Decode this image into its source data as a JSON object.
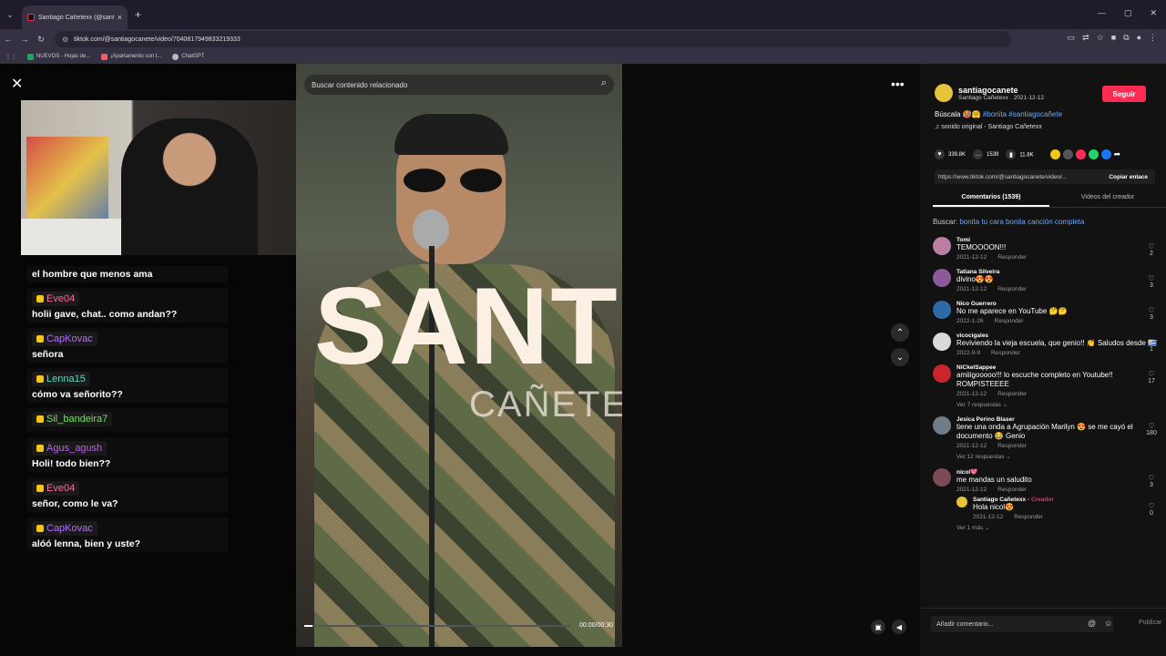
{
  "browser": {
    "tab_title": "Santiago Cañetexx (@santi...",
    "url": "tiktok.com/@santiagocanete/video/7040817949833219333",
    "bookmarks": [
      "NUEVOS - Hojas de...",
      "¡Apartamento con t...",
      "ChatGPT"
    ]
  },
  "chat": [
    {
      "user": "",
      "text": "el hombre que menos ama",
      "color": "#ffffff"
    },
    {
      "user": "Eve04",
      "text": "holii gave, chat.. como andan??",
      "color": "#ff6b9d"
    },
    {
      "user": "CapKovac",
      "text": "señora",
      "color": "#b46bff"
    },
    {
      "user": "Lenna15",
      "text": "cómo va señorito??",
      "color": "#5fd7c0"
    },
    {
      "user": "Sil_bandeira7",
      "text": "",
      "color": "#77dd66"
    },
    {
      "user": "Agus_agush",
      "text": "Holi! todo bien??",
      "color": "#c25bff"
    },
    {
      "user": "Eve04",
      "text": "señor, como le va?",
      "color": "#ff6b9d"
    },
    {
      "user": "CapKovac",
      "text": "alóó lenna, bien y uste?",
      "color": "#b46bff"
    }
  ],
  "video": {
    "search_placeholder": "Buscar contenido relacionado",
    "overlay_title": "SANTIA",
    "overlay_sub": "CAÑETE",
    "time": "00:00/00:30",
    "progress": 0.03
  },
  "author": {
    "username": "santiagocanete",
    "display": "Santiago Cañetexx · 2021-12-12",
    "follow": "Seguir",
    "desc_text": "Búscala 🥵🤗 ",
    "desc_tags": "#bonita #santiagocañete",
    "music": "♫  sonido original - Santiago Cañetexx"
  },
  "stats": {
    "likes": "339.8K",
    "comments": "1539",
    "saves": "11.8K"
  },
  "link": {
    "url": "https://www.tiktok.com/@santiagocanete/video/...",
    "copy": "Copiar enlace"
  },
  "tabs": [
    "Comentarios (1539)",
    "Videos del creador"
  ],
  "buscar": {
    "label": "Buscar:",
    "query": "bonita tu cara bonita canción completa"
  },
  "reply_label": "Responder",
  "comments": [
    {
      "name": "Tomi",
      "text": "TEMOOOON!!!",
      "date": "2021-12-12",
      "likes": "2",
      "color": "#b97fa2"
    },
    {
      "name": "Tatiana Silveira",
      "text": "divino😍😍",
      "date": "2021-12-12",
      "likes": "3",
      "color": "#8c5a9c"
    },
    {
      "name": "Nico Guerrero",
      "text": "No me aparece en YouTube 🤔🤔",
      "date": "2022-1-26",
      "likes": "3",
      "color": "#2e6aa6"
    },
    {
      "name": "vicocigales",
      "text": "Reviviendo la vieja escuela, que genio!! 👏 Saludos desde 🇺🇾",
      "date": "2022-9-9",
      "likes": "1",
      "color": "#d9d9d9"
    },
    {
      "name": "NiCkelSappee",
      "text": "amiiigooooo!!! lo escuche completo en Youtube!! ROMPISTEEEE",
      "date": "2021-12-12",
      "likes": "17",
      "color": "#c9252c",
      "replies": "Ver 7 respuestas ⌄"
    },
    {
      "name": "Jesica Perino Blaser",
      "text": "tiene una onda a Agrupación Marilyn 😍 se me cayó el documento 😂 Genio",
      "date": "2021-12-12",
      "likes": "180",
      "color": "#6f7d88",
      "replies": "Ver 12 respuestas ⌄"
    },
    {
      "name": "nicol💖",
      "text": "me mandas un saludito",
      "date": "2021-12-12",
      "likes": "3",
      "color": "#7a4a55"
    }
  ],
  "creator_reply": {
    "name": "Santiago Cañetexx",
    "tag": "Creador",
    "text": "Hola nicol😍",
    "date": "2021-12-12",
    "likes": "0",
    "more": "Ver 1 más ⌄"
  },
  "composer": {
    "placeholder": "Añadir comentario...",
    "publish": "Publicar"
  }
}
